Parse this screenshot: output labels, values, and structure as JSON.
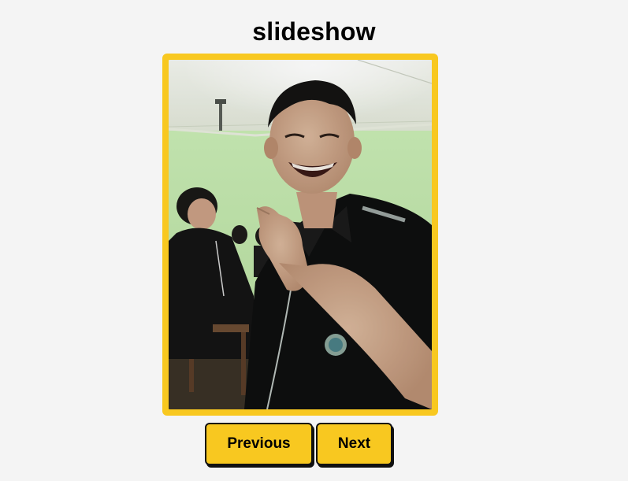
{
  "page": {
    "title": "slideshow"
  },
  "slide": {
    "image_description": "Smiling student in black school uniform waving in a classroom with green walls"
  },
  "controls": {
    "previous_label": "Previous",
    "next_label": "Next"
  },
  "colors": {
    "background": "#f4f4f4",
    "accent": "#f8c820",
    "border": "#111111"
  }
}
